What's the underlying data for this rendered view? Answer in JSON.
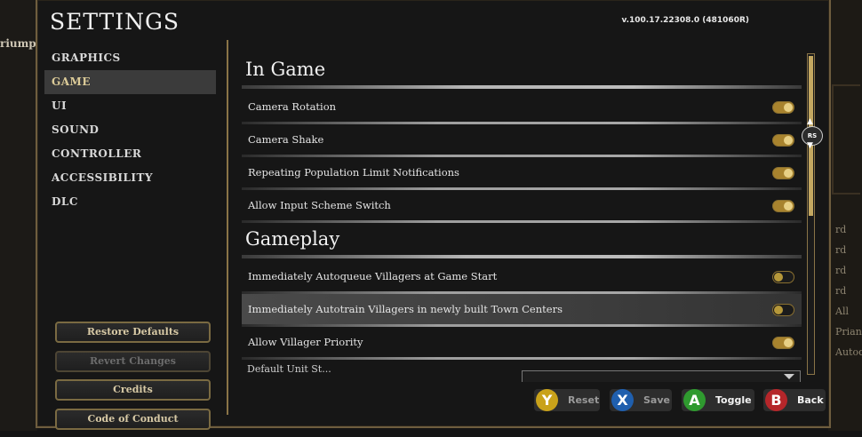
{
  "background": {
    "left_text": "riumph",
    "right_items": [
      "rd",
      "rd",
      "rd",
      "rd",
      "All",
      "Prian",
      "Autoq"
    ]
  },
  "header": {
    "title": "SETTINGS",
    "version": "v.100.17.22308.0 (481060R)"
  },
  "sidebar": {
    "items": [
      {
        "label": "GRAPHICS"
      },
      {
        "label": "GAME",
        "active": true
      },
      {
        "label": "UI"
      },
      {
        "label": "SOUND"
      },
      {
        "label": "CONTROLLER"
      },
      {
        "label": "ACCESSIBILITY"
      },
      {
        "label": "DLC"
      }
    ],
    "buttons": {
      "restore": "Restore Defaults",
      "revert": "Revert Changes",
      "credits": "Credits",
      "conduct": "Code of Conduct"
    }
  },
  "in_game": {
    "title": "In Game",
    "rows": [
      {
        "label": "Camera Rotation",
        "on": true
      },
      {
        "label": "Camera Shake",
        "on": true
      },
      {
        "label": "Repeating Population Limit Notifications",
        "on": true
      },
      {
        "label": "Allow Input Scheme Switch",
        "on": true
      }
    ]
  },
  "gameplay": {
    "title": "Gameplay",
    "rows": [
      {
        "label": "Immediately Autoqueue Villagers at Game Start",
        "on": false
      },
      {
        "label": "Immediately Autotrain Villagers in newly built Town Centers",
        "on": false
      },
      {
        "label": "Allow Villager Priority",
        "on": true
      }
    ],
    "cut_label": "Default Unit St..."
  },
  "scroll_indicator": {
    "label": "RS"
  },
  "footer": {
    "reset": {
      "key": "Y",
      "label": "Reset"
    },
    "save": {
      "key": "X",
      "label": "Save"
    },
    "toggle": {
      "key": "A",
      "label": "Toggle"
    },
    "back": {
      "key": "B",
      "label": "Back"
    }
  },
  "colors": {
    "accent_gold": "#c4a861",
    "key_y": "#c9a21a",
    "key_x": "#1f5fae",
    "key_a": "#2f9a2f",
    "key_b": "#b5262a"
  }
}
